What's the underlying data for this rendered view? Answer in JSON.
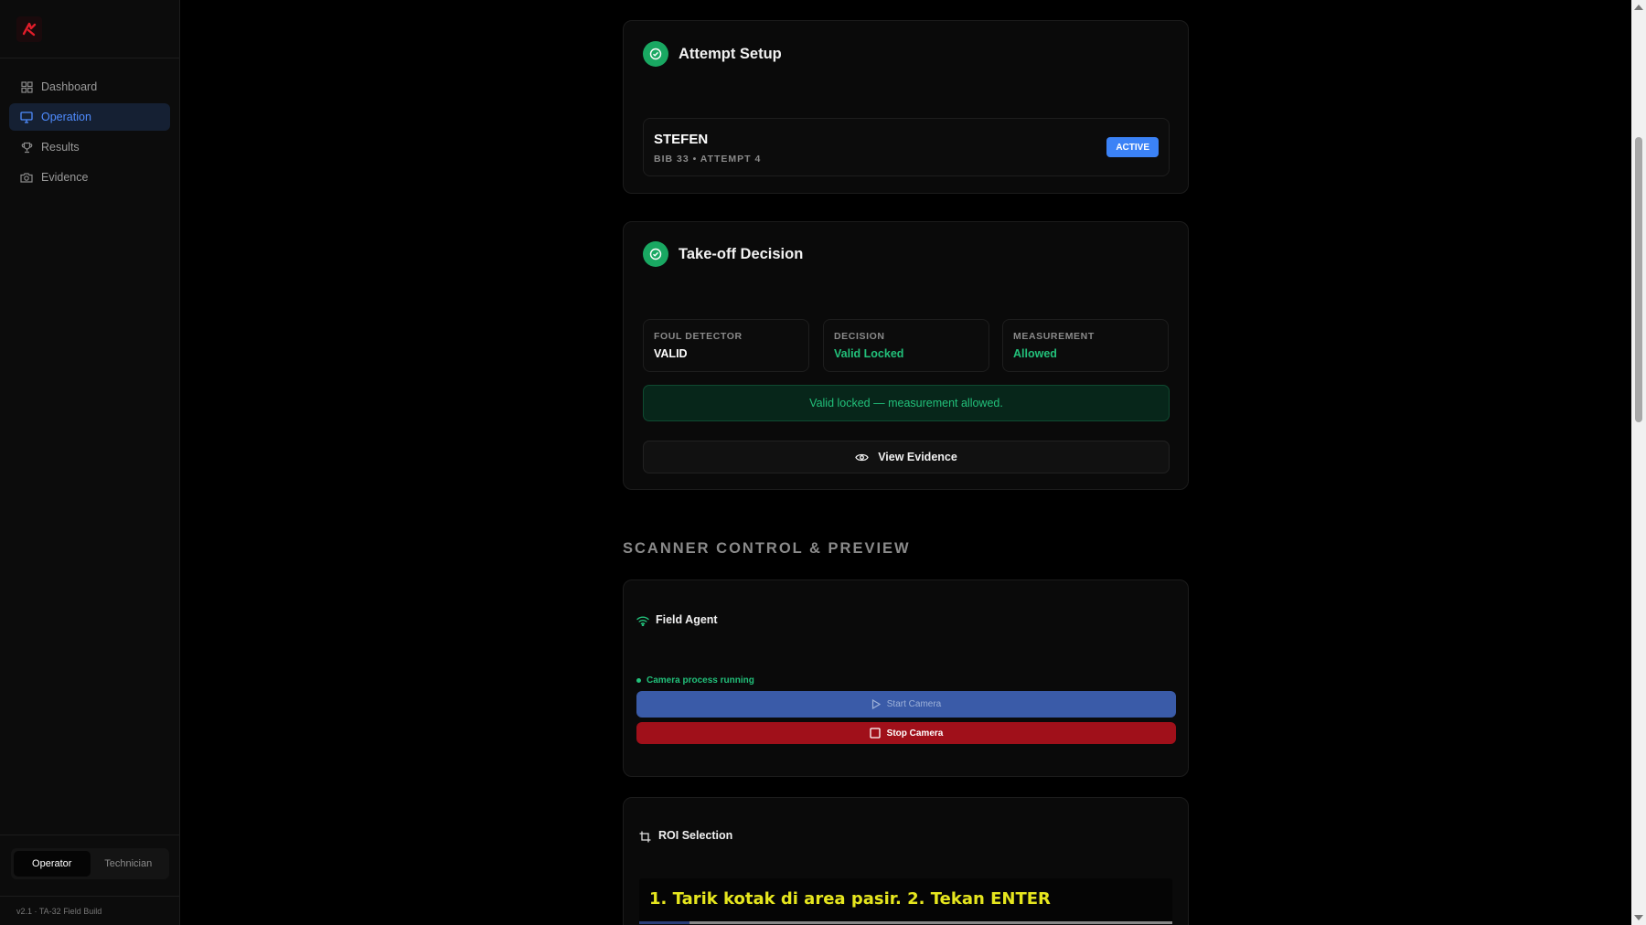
{
  "sidebar": {
    "logo": "jump-logo-icon",
    "items": [
      {
        "label": "Dashboard",
        "icon": "grid-icon",
        "active": false
      },
      {
        "label": "Operation",
        "icon": "monitor-icon",
        "active": true
      },
      {
        "label": "Results",
        "icon": "trophy-icon",
        "active": false
      },
      {
        "label": "Evidence",
        "icon": "camera-icon",
        "active": false
      }
    ],
    "roles": {
      "operator": "Operator",
      "technician": "Technician",
      "active": "Operator"
    },
    "version": "v2.1 · TA-32 Field Build"
  },
  "attempt_setup": {
    "title": "Attempt Setup",
    "athlete_name": "STEFEN",
    "athlete_sub": "BIB 33 • ATTEMPT 4",
    "status_badge": "ACTIVE"
  },
  "takeoff": {
    "title": "Take-off Decision",
    "stats": [
      {
        "label": "FOUL DETECTOR",
        "value": "VALID",
        "color": "#ffffff"
      },
      {
        "label": "DECISION",
        "value": "Valid Locked",
        "color": "#22c07a"
      },
      {
        "label": "MEASUREMENT",
        "value": "Allowed",
        "color": "#22c07a"
      }
    ],
    "banner": "Valid locked — measurement allowed.",
    "view_evidence": "View Evidence"
  },
  "scanner": {
    "heading": "SCANNER CONTROL & PREVIEW",
    "field_agent_title": "Field Agent",
    "status": "Camera process running",
    "start_label": "Start Camera",
    "stop_label": "Stop Camera"
  },
  "roi": {
    "title": "ROI Selection",
    "instruction": "1. Tarik kotak di area pasir. 2. Tekan ENTER"
  },
  "colors": {
    "accent": "#3b82f6",
    "success": "#19a862",
    "danger": "#a0101a"
  }
}
